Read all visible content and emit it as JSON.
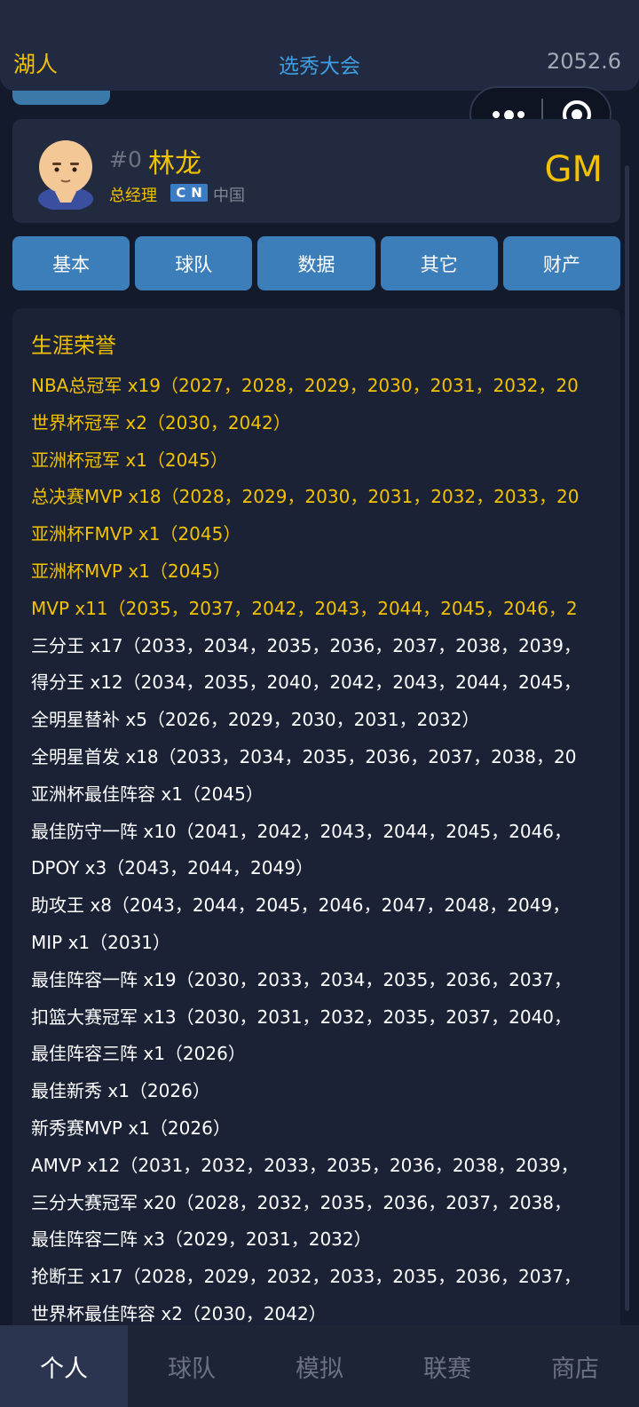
{
  "header": {
    "team": "湖人",
    "title": "选秀大会",
    "date": "2052.6"
  },
  "profile": {
    "number": "#0",
    "name": "林龙",
    "role": "总经理",
    "flag_letters": [
      "C",
      "N"
    ],
    "country": "中国",
    "badge": "GM"
  },
  "tabs": [
    "基本",
    "球队",
    "数据",
    "其它",
    "财产"
  ],
  "honors": {
    "title": "生涯荣誉",
    "items": [
      {
        "text": "NBA总冠军 x19（2027，2028，2029，2030，2031，2032，20",
        "gold": true
      },
      {
        "text": "世界杯冠军 x2（2030，2042）",
        "gold": true
      },
      {
        "text": "亚洲杯冠军 x1（2045）",
        "gold": true
      },
      {
        "text": "总决赛MVP x18（2028，2029，2030，2031，2032，2033，20",
        "gold": true
      },
      {
        "text": "亚洲杯FMVP x1（2045）",
        "gold": true
      },
      {
        "text": "亚洲杯MVP x1（2045）",
        "gold": true
      },
      {
        "text": "MVP x11（2035，2037，2042，2043，2044，2045，2046，2",
        "gold": true
      },
      {
        "text": "三分王 x17（2033，2034，2035，2036，2037，2038，2039，",
        "gold": false
      },
      {
        "text": "得分王 x12（2034，2035，2040，2042，2043，2044，2045，",
        "gold": false
      },
      {
        "text": "全明星替补 x5（2026，2029，2030，2031，2032）",
        "gold": false
      },
      {
        "text": "全明星首发 x18（2033，2034，2035，2036，2037，2038，20",
        "gold": false
      },
      {
        "text": "亚洲杯最佳阵容 x1（2045）",
        "gold": false
      },
      {
        "text": "最佳防守一阵 x10（2041，2042，2043，2044，2045，2046，",
        "gold": false
      },
      {
        "text": "DPOY x3（2043，2044，2049）",
        "gold": false
      },
      {
        "text": "助攻王 x8（2043，2044，2045，2046，2047，2048，2049，",
        "gold": false
      },
      {
        "text": "MIP x1（2031）",
        "gold": false
      },
      {
        "text": "最佳阵容一阵 x19（2030，2033，2034，2035，2036，2037，",
        "gold": false
      },
      {
        "text": "扣篮大赛冠军 x13（2030，2031，2032，2035，2037，2040，",
        "gold": false
      },
      {
        "text": "最佳阵容三阵 x1（2026）",
        "gold": false
      },
      {
        "text": "最佳新秀 x1（2026）",
        "gold": false
      },
      {
        "text": "新秀赛MVP x1（2026）",
        "gold": false
      },
      {
        "text": "AMVP x12（2031，2032，2033，2035，2036，2038，2039，",
        "gold": false
      },
      {
        "text": "三分大赛冠军 x20（2028，2032，2035，2036，2037，2038，",
        "gold": false
      },
      {
        "text": "最佳阵容二阵 x3（2029，2031，2032）",
        "gold": false
      },
      {
        "text": "抢断王 x17（2028，2029，2032，2033，2035，2036，2037，",
        "gold": false
      },
      {
        "text": "世界杯最佳阵容 x2（2030，2042）",
        "gold": false
      }
    ]
  },
  "bottom_nav": [
    {
      "label": "个人",
      "active": true
    },
    {
      "label": "球队",
      "active": false
    },
    {
      "label": "模拟",
      "active": false
    },
    {
      "label": "联赛",
      "active": false
    },
    {
      "label": "商店",
      "active": false
    }
  ],
  "colors": {
    "background": "#131a2b",
    "card": "#222a40",
    "accent_gold": "#f2c200",
    "tab_blue": "#3c7eb9",
    "title_blue": "#3f9ee3"
  }
}
